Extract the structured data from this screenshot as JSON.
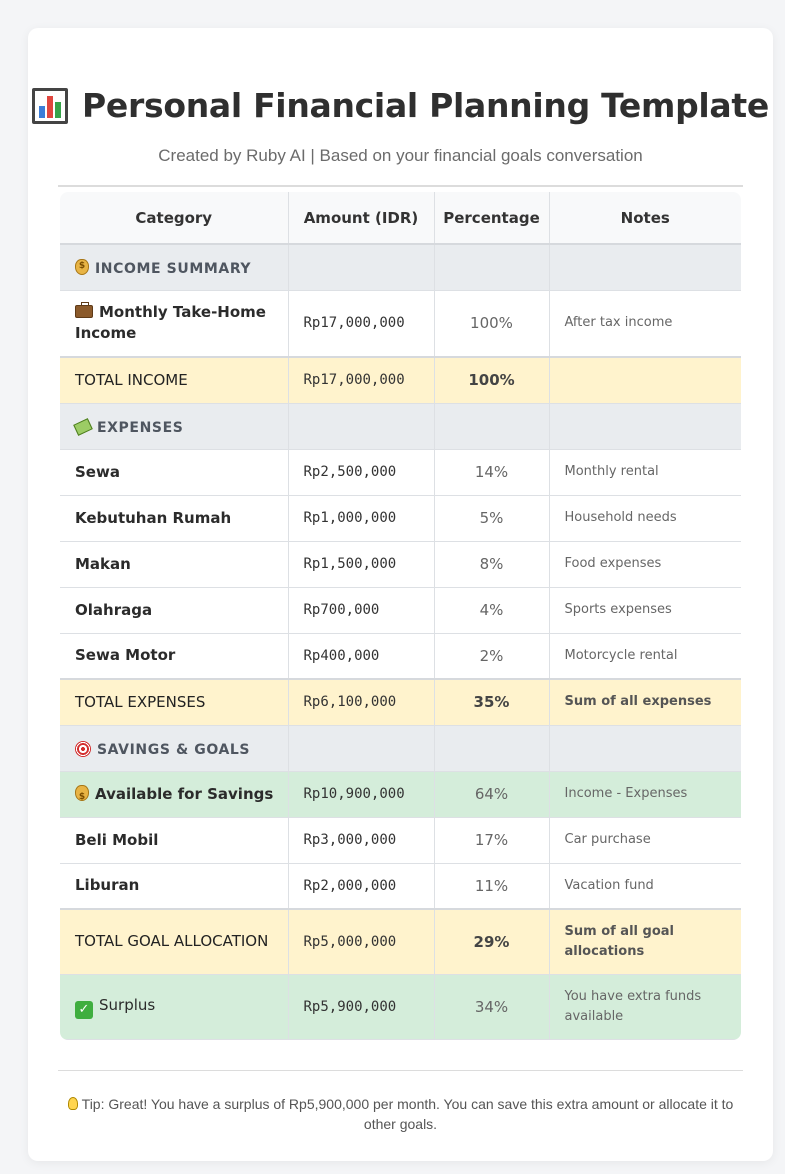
{
  "header": {
    "icon": "bar-chart-icon",
    "title": "Personal Financial Planning Template",
    "subtitle": "Created by Ruby AI | Based on your financial goals conversation"
  },
  "table": {
    "columns": [
      "Category",
      "Amount (IDR)",
      "Percentage",
      "Notes"
    ],
    "income_section": {
      "icon": "money-bag-icon",
      "label": "INCOME SUMMARY"
    },
    "income_rows": [
      {
        "icon": "briefcase-icon",
        "category": "Monthly Take-Home Income",
        "amount": "Rp17,000,000",
        "percentage": "100%",
        "notes": "After tax income"
      }
    ],
    "total_income": {
      "category": "TOTAL INCOME",
      "amount": "Rp17,000,000",
      "percentage": "100%",
      "notes": ""
    },
    "expenses_section": {
      "icon": "flying-money-icon",
      "label": "EXPENSES"
    },
    "expense_rows": [
      {
        "category": "Sewa",
        "amount": "Rp2,500,000",
        "percentage": "14%",
        "notes": "Monthly rental"
      },
      {
        "category": "Kebutuhan Rumah",
        "amount": "Rp1,000,000",
        "percentage": "5%",
        "notes": "Household needs"
      },
      {
        "category": "Makan",
        "amount": "Rp1,500,000",
        "percentage": "8%",
        "notes": "Food expenses"
      },
      {
        "category": "Olahraga",
        "amount": "Rp700,000",
        "percentage": "4%",
        "notes": "Sports expenses"
      },
      {
        "category": "Sewa Motor",
        "amount": "Rp400,000",
        "percentage": "2%",
        "notes": "Motorcycle rental"
      }
    ],
    "total_expenses": {
      "category": "TOTAL EXPENSES",
      "amount": "Rp6,100,000",
      "percentage": "35%",
      "notes": "Sum of all expenses"
    },
    "savings_section": {
      "icon": "target-icon",
      "label": "SAVINGS & GOALS"
    },
    "available": {
      "icon": "money-bag-icon",
      "category": "Available for Savings",
      "amount": "Rp10,900,000",
      "percentage": "64%",
      "notes": "Income - Expenses"
    },
    "goal_rows": [
      {
        "category": "Beli Mobil",
        "amount": "Rp3,000,000",
        "percentage": "17%",
        "notes": "Car purchase"
      },
      {
        "category": "Liburan",
        "amount": "Rp2,000,000",
        "percentage": "11%",
        "notes": "Vacation fund"
      }
    ],
    "total_goals": {
      "category": "TOTAL GOAL ALLOCATION",
      "amount": "Rp5,000,000",
      "percentage": "29%",
      "notes": "Sum of all goal allocations"
    },
    "surplus": {
      "icon": "check-mark-icon",
      "category": "Surplus",
      "amount": "Rp5,900,000",
      "percentage": "34%",
      "notes": "You have extra funds available"
    }
  },
  "tip": {
    "icon": "light-bulb-icon",
    "text": "Tip: Great! You have a surplus of Rp5,900,000 per month. You can save this extra amount or allocate it to other goals."
  },
  "colors": {
    "section_bg": "#e9ecef",
    "total_bg": "#fff3cd",
    "highlight_green": "#d4edda"
  }
}
